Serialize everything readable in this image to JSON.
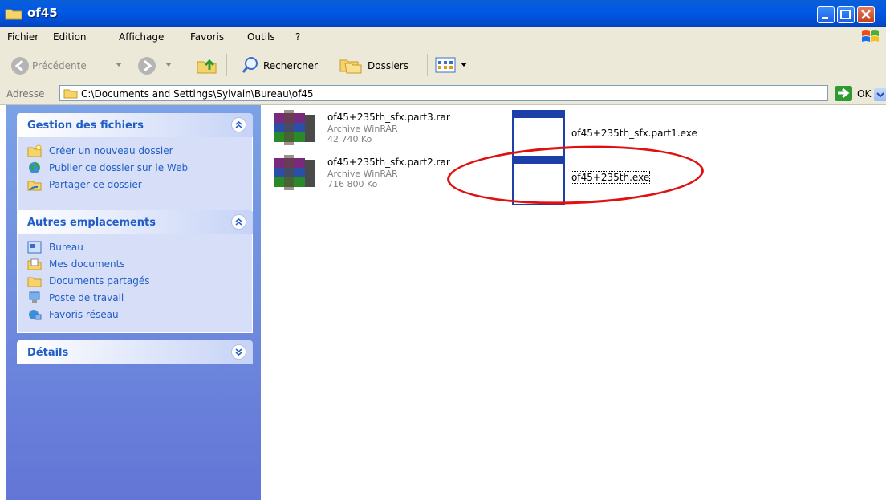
{
  "window": {
    "title": "of45"
  },
  "menu": [
    "Fichier",
    "Edition",
    "Affichage",
    "Favoris",
    "Outils",
    "?"
  ],
  "toolbar": {
    "back": "Précédente",
    "search": "Rechercher",
    "folders": "Dossiers"
  },
  "address": {
    "label": "Adresse",
    "path": "C:\\Documents and Settings\\Sylvain\\Bureau\\of45",
    "ok": "OK"
  },
  "panels": {
    "files": {
      "title": "Gestion des fichiers",
      "links": [
        "Créer un nouveau dossier",
        "Publier ce dossier sur le Web",
        "Partager ce dossier"
      ]
    },
    "places": {
      "title": "Autres emplacements",
      "links": [
        "Bureau",
        "Mes documents",
        "Documents partagés",
        "Poste de travail",
        "Favoris réseau"
      ]
    },
    "details": {
      "title": "Détails"
    }
  },
  "files": [
    {
      "name": "of45+235th_sfx.part3.rar",
      "type": "Archive WinRAR",
      "size": "42 740 Ko"
    },
    {
      "name": "of45+235th_sfx.part2.rar",
      "type": "Archive WinRAR",
      "size": "716 800 Ko"
    },
    {
      "name": "of45+235th_sfx.part1.exe"
    },
    {
      "name": "of45+235th.exe"
    }
  ],
  "colors": {
    "titlebar": "#0058e6",
    "link": "#215dc6",
    "highlight": "#e01010"
  }
}
